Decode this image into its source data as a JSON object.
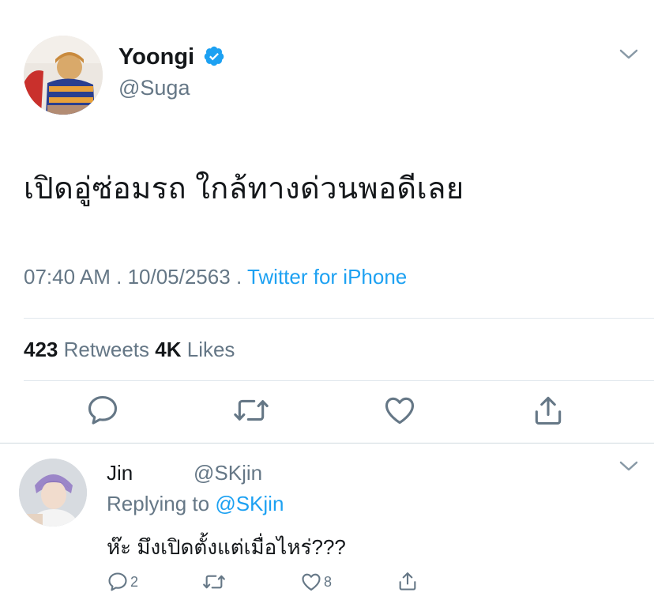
{
  "tweet": {
    "display_name": "Yoongi",
    "handle": "@Suga",
    "text": "เปิดอู่ซ่อมรถ ใกล้ทางด่วนพอดีเลย",
    "time": "07:40 AM",
    "date_sep": ".",
    "date": "10/05/2563",
    "source_sep": ".",
    "source": "Twitter for iPhone",
    "retweets_count": "423",
    "retweets_label": "Retweets",
    "likes_count": "4K",
    "likes_label": "Likes"
  },
  "reply": {
    "display_name": "Jin",
    "handle": "@SKjin",
    "replying_label": "Replying to",
    "replying_to": "@SKjin",
    "text": "ห๊ะ มึงเปิดตั้งแต่เมื่อไหร่???",
    "reply_count": "2",
    "retweet_count": "",
    "like_count": "8"
  },
  "colors": {
    "accent": "#1da1f2",
    "text": "#14171a",
    "secondary": "#657786",
    "divider": "#e1e8ed"
  },
  "icons": {
    "verified": "verified-badge-icon",
    "chevron": "chevron-down-icon",
    "reply": "reply-icon",
    "retweet": "retweet-icon",
    "like": "heart-icon",
    "share": "share-icon"
  }
}
